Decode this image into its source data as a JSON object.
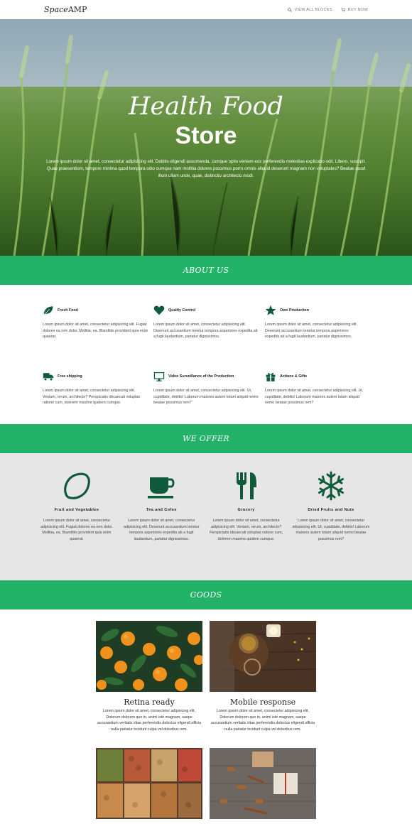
{
  "header": {
    "logo_italic": "Space",
    "logo_rest": "AMP",
    "nav_view_all": "VIEW ALL BLOCKS",
    "nav_buy": "BUY NOW"
  },
  "hero": {
    "title": "Health Food",
    "subtitle": "Store",
    "text": "Lorem ipsum dolor sit amet, consectetur adipisicing elit. Debitis eligendi assumenda, cumque optio veniam eos perferendis molestias explicabo odit. Libero, suscipit. Quae praesentium, tempore minima quod tempora odio cumque nam mollitia dolores possimus porro omnis aliquid deserunt magnam non voluptates? Beatae quod illum ullam unde, quae, distinctio architecto modi."
  },
  "about": {
    "heading": "ABOUT US",
    "features": [
      {
        "title": "Fresh Food",
        "icon": "leaf-icon",
        "text": "Lorem ipsum dolor sit amet, consectetur adipisicing elit. Fugiat dolores ea rem dolor. Mollitia, ea. Blanditiis provident quia enim quaerat."
      },
      {
        "title": "Quality Control",
        "icon": "heart-icon",
        "text": "Lorem ipsum dolor sit amet, consectetur adipisicing elit. Deserunt accusantium tenetur tempora asperiores expedita ab a fugit laudantium, pariatur dignissimos."
      },
      {
        "title": "Own Production",
        "icon": "star-icon",
        "text": "Lorem ipsum dolor sit amet, consectetur adipisicing elit. Deserunt accusantium tenetur tempora asperiores expedita ab a fugit laudantium, pariatur dignissimos."
      },
      {
        "title": "Free shipping",
        "icon": "truck-icon",
        "text": "Lorem ipsum dolor sit amet, consectetur adipisicing elit. Veniam, rerum, architecto? Perspiciatis obcaecati voluptas ratione cum, dolorem maxime quidem cumque."
      },
      {
        "title": "Video Surveillance of the Production",
        "icon": "monitor-icon",
        "text": "Lorem ipsum dolor sit amet, consectetur adipisicing elit. Ut, cupiditate, debitis! Laborum maiores autem totam aliquid nemo beatae possimus rem?"
      },
      {
        "title": "Actions & Gifts",
        "icon": "gift-icon",
        "text": "Lorem ipsum dolor sit amet, consectetur adipisicing elit. Ut, cupiditate, debitis! Laborum maiores autem totam aliquid nemo beatae possimus rem?"
      }
    ]
  },
  "offer": {
    "heading": "WE OFFER",
    "items": [
      {
        "title": "Fruit and Vegetables",
        "icon": "lemon-icon",
        "text": "Lorem ipsum dolor sit amet, consectetur adipisicing elit. Fugiat dolores ea rem dolor. Mollitia, ea. Blanditiis provident quia enim quaerat."
      },
      {
        "title": "Tea and Cofee",
        "icon": "coffee-cup-icon",
        "text": "Lorem ipsum dolor sit amet, consectetur adipisicing elit. Deserunt accusantium tenetur tempora asperiores expedita ab a fugit laudantium, pariatur dignissimos."
      },
      {
        "title": "Grocery",
        "icon": "fork-knife-icon",
        "text": "Lorem ipsum dolor sit amet, consectetur adipisicing elit. Veniam, rerum, architecto? Perspiciatis obcaecati voluptas ratione cum, dolorem maxime quidem cumque."
      },
      {
        "title": "Dried Fruits and Nuts",
        "icon": "snowflake-icon",
        "text": "Lorem ipsum dolor sit amet, consectetur adipisicing elit. Ut, cupiditate, debitis! Laborum maiores autem totam aliquid nemo beatae possimus rem?"
      }
    ]
  },
  "goods": {
    "heading": "GOODS",
    "items": [
      {
        "title": "Retina ready",
        "text": "Lorem ipsum dolor sit amet, consectetur adipisicing elit. Dolorum dolorem quo in, animi iste magnam, saepe accusantium veritatis vitae perferendis delectus eligendi officia nulla pariatur incidunt culpa vel doloribus rem."
      },
      {
        "title": "Mobile response",
        "text": "Lorem ipsum dolor sit amet, consectetur adipisicing elit. Dolorum dolorem quo in, animi iste magnam, saepe accusantium veritatis vitae perferendis delectus eligendi officia nulla pariatur incidunt culpa vel doloribus rem."
      }
    ]
  },
  "colors": {
    "accent": "#22b268",
    "icon": "#0e5a3a",
    "offer_bg": "#e6e6e6"
  }
}
